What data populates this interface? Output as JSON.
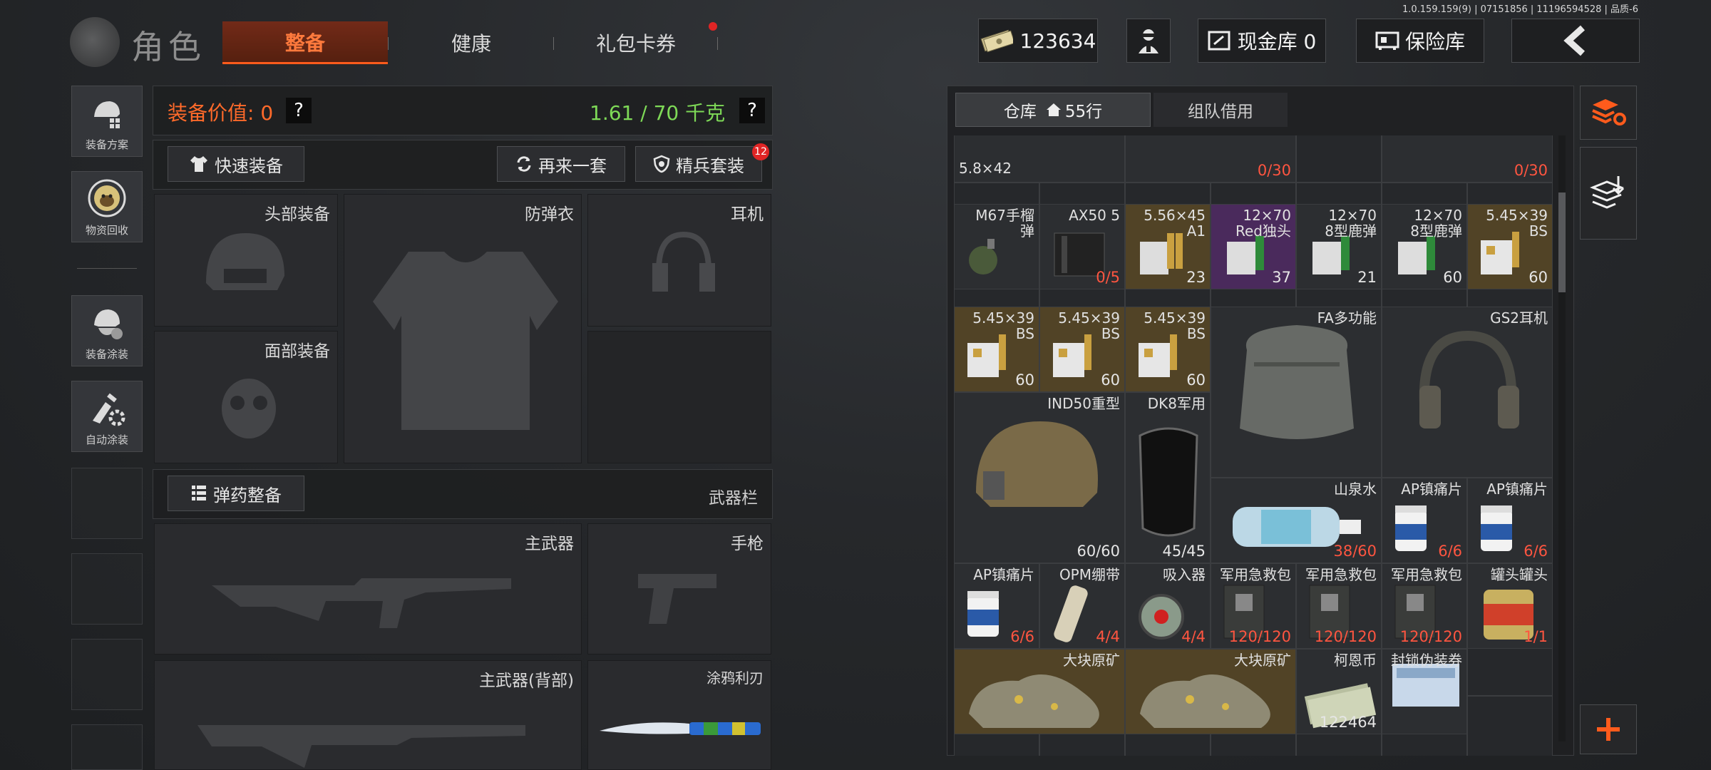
{
  "version": "1.0.159.159(9) | 07151856 | 11196594528 | 品质-6",
  "header": {
    "role": "角色",
    "tabs": [
      {
        "label": "整备",
        "active": true
      },
      {
        "label": "健康"
      },
      {
        "label": "礼包卡券",
        "badge": true
      }
    ],
    "money": "123634",
    "cash_vault": "现金库 0",
    "safe": "保险库",
    "back_icon": "chevron-left-icon"
  },
  "sidebar": [
    {
      "label": "装备方案",
      "icon": "gear-plan-icon"
    },
    {
      "label": "物资回收",
      "icon": "recycle-icon"
    },
    {
      "label": "装备涂装",
      "icon": "paint-helmet-icon"
    },
    {
      "label": "自动涂装",
      "icon": "auto-paint-icon"
    }
  ],
  "equipment": {
    "value_label": "装备价值: 0",
    "weight": "1.61 / 70 千克",
    "help": "?",
    "quick_equip": "快速装备",
    "again": "再来一套",
    "elite": "精兵套装",
    "elite_badge": "12",
    "slots": {
      "head": "头部装备",
      "armor": "防弹衣",
      "headset": "耳机",
      "face": "面部装备"
    },
    "ammo_button": "弹药整备",
    "weapon_bar": "武器栏",
    "weapon_slots": {
      "primary": "主武器",
      "pistol": "手枪",
      "primary_back": "主武器(背部)",
      "knife": "涂鸦利刃"
    }
  },
  "warehouse": {
    "tab_warehouse": "仓库",
    "rows": "55行",
    "tab_team": "组队借用",
    "items": [
      {
        "id": "ammo-58",
        "name": "5.8×42",
        "count": "",
        "color": "none"
      },
      {
        "id": "top-c3",
        "name": "",
        "count": "0/30",
        "color": "none"
      },
      {
        "id": "top-c6",
        "name": "",
        "count": "0/30",
        "color": "none"
      },
      {
        "id": "m67",
        "name": "M67手榴\n弹",
        "count": "",
        "color": "none"
      },
      {
        "id": "ax50",
        "name": "AX50 5",
        "count": "0/5",
        "color": "none"
      },
      {
        "id": "a1",
        "name": "5.56×45\nA1",
        "count": "23",
        "color": "yellow"
      },
      {
        "id": "red",
        "name": "12×70\nRed独头",
        "count": "37",
        "color": "purple"
      },
      {
        "id": "deer8a",
        "name": "12×70\n8型鹿弹",
        "count": "21",
        "color": "none"
      },
      {
        "id": "deer8b",
        "name": "12×70\n8型鹿弹",
        "count": "60",
        "color": "none"
      },
      {
        "id": "bs1",
        "name": "5.45×39\nBS",
        "count": "60",
        "color": "yellow"
      },
      {
        "id": "bs2",
        "name": "5.45×39\nBS",
        "count": "60",
        "color": "yellow"
      },
      {
        "id": "bs3",
        "name": "5.45×39\nBS",
        "count": "60",
        "color": "yellow"
      },
      {
        "id": "bs4",
        "name": "5.45×39\nBS",
        "count": "60",
        "color": "yellow"
      },
      {
        "id": "fa",
        "name": "FA多功能",
        "count": "",
        "color": "none"
      },
      {
        "id": "gs2",
        "name": "GS2耳机",
        "count": "",
        "color": "none"
      },
      {
        "id": "ind50",
        "name": "IND50重型",
        "count": "60/60",
        "color": "none"
      },
      {
        "id": "dk8",
        "name": "DK8军用",
        "count": "45/45",
        "color": "none"
      },
      {
        "id": "water",
        "name": "山泉水",
        "count": "38/60",
        "color": "none"
      },
      {
        "id": "ap1",
        "name": "AP镇痛片",
        "count": "6/6",
        "color": "none"
      },
      {
        "id": "ap2",
        "name": "AP镇痛片",
        "count": "6/6",
        "color": "none"
      },
      {
        "id": "ap3",
        "name": "AP镇痛片",
        "count": "6/6",
        "color": "none"
      },
      {
        "id": "opm",
        "name": "OPM绷带",
        "count": "4/4",
        "color": "none"
      },
      {
        "id": "inhaler",
        "name": "吸入器",
        "count": "4/4",
        "color": "none"
      },
      {
        "id": "kit1",
        "name": "军用急救包",
        "count": "120/120",
        "color": "none"
      },
      {
        "id": "kit2",
        "name": "军用急救包",
        "count": "120/120",
        "color": "none"
      },
      {
        "id": "kit3",
        "name": "军用急救包",
        "count": "120/120",
        "color": "none"
      },
      {
        "id": "can",
        "name": "罐头罐头",
        "count": "1/1",
        "color": "none"
      },
      {
        "id": "ore1",
        "name": "大块原矿",
        "count": "",
        "color": "yellow"
      },
      {
        "id": "ore2",
        "name": "大块原矿",
        "count": "",
        "color": "yellow"
      },
      {
        "id": "coin",
        "name": "柯恩币",
        "count": "122464",
        "color": "none"
      },
      {
        "id": "sealed",
        "name": "封锁伪装券",
        "count": "",
        "color": "none"
      }
    ]
  },
  "right_tools": [
    "layers-refresh-icon",
    "layers-download-icon",
    "plus-icon"
  ]
}
